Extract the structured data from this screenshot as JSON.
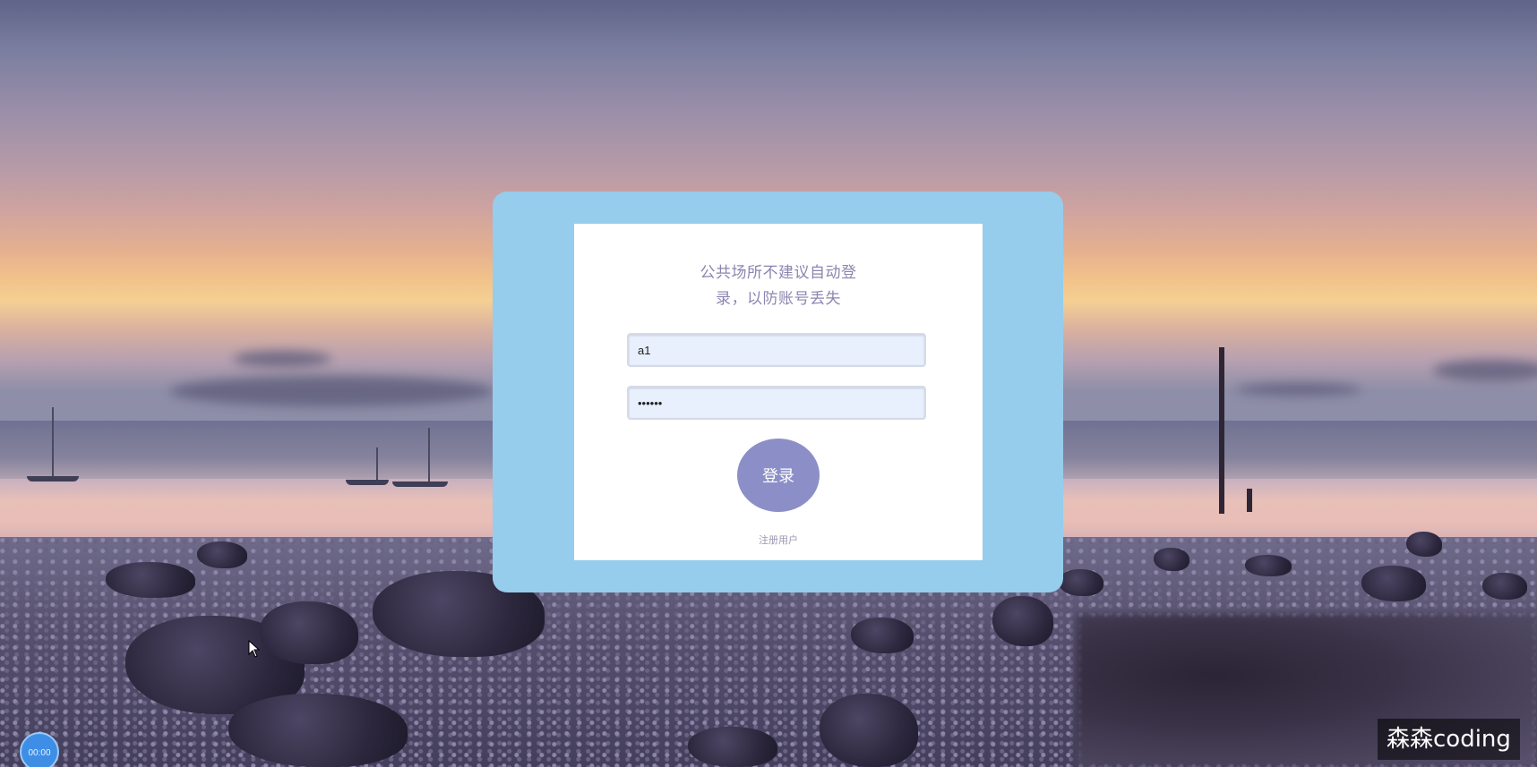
{
  "login": {
    "notice_line1": "公共场所不建议自动登",
    "notice_line2": "录，以防账号丢失",
    "username_value": "a1",
    "password_value": "••••••",
    "login_button": "登录",
    "register_link": "注册用户"
  },
  "overlay": {
    "watermark": "森森coding",
    "timer": "00:00"
  },
  "icons": {
    "cursor": "mouse-pointer-icon"
  },
  "colors": {
    "card_frame": "#96cdec",
    "card_body": "#ffffff",
    "login_button": "#8c8fc7",
    "notice_text": "#8b86b0",
    "input_bg": "#e8f0fe"
  }
}
